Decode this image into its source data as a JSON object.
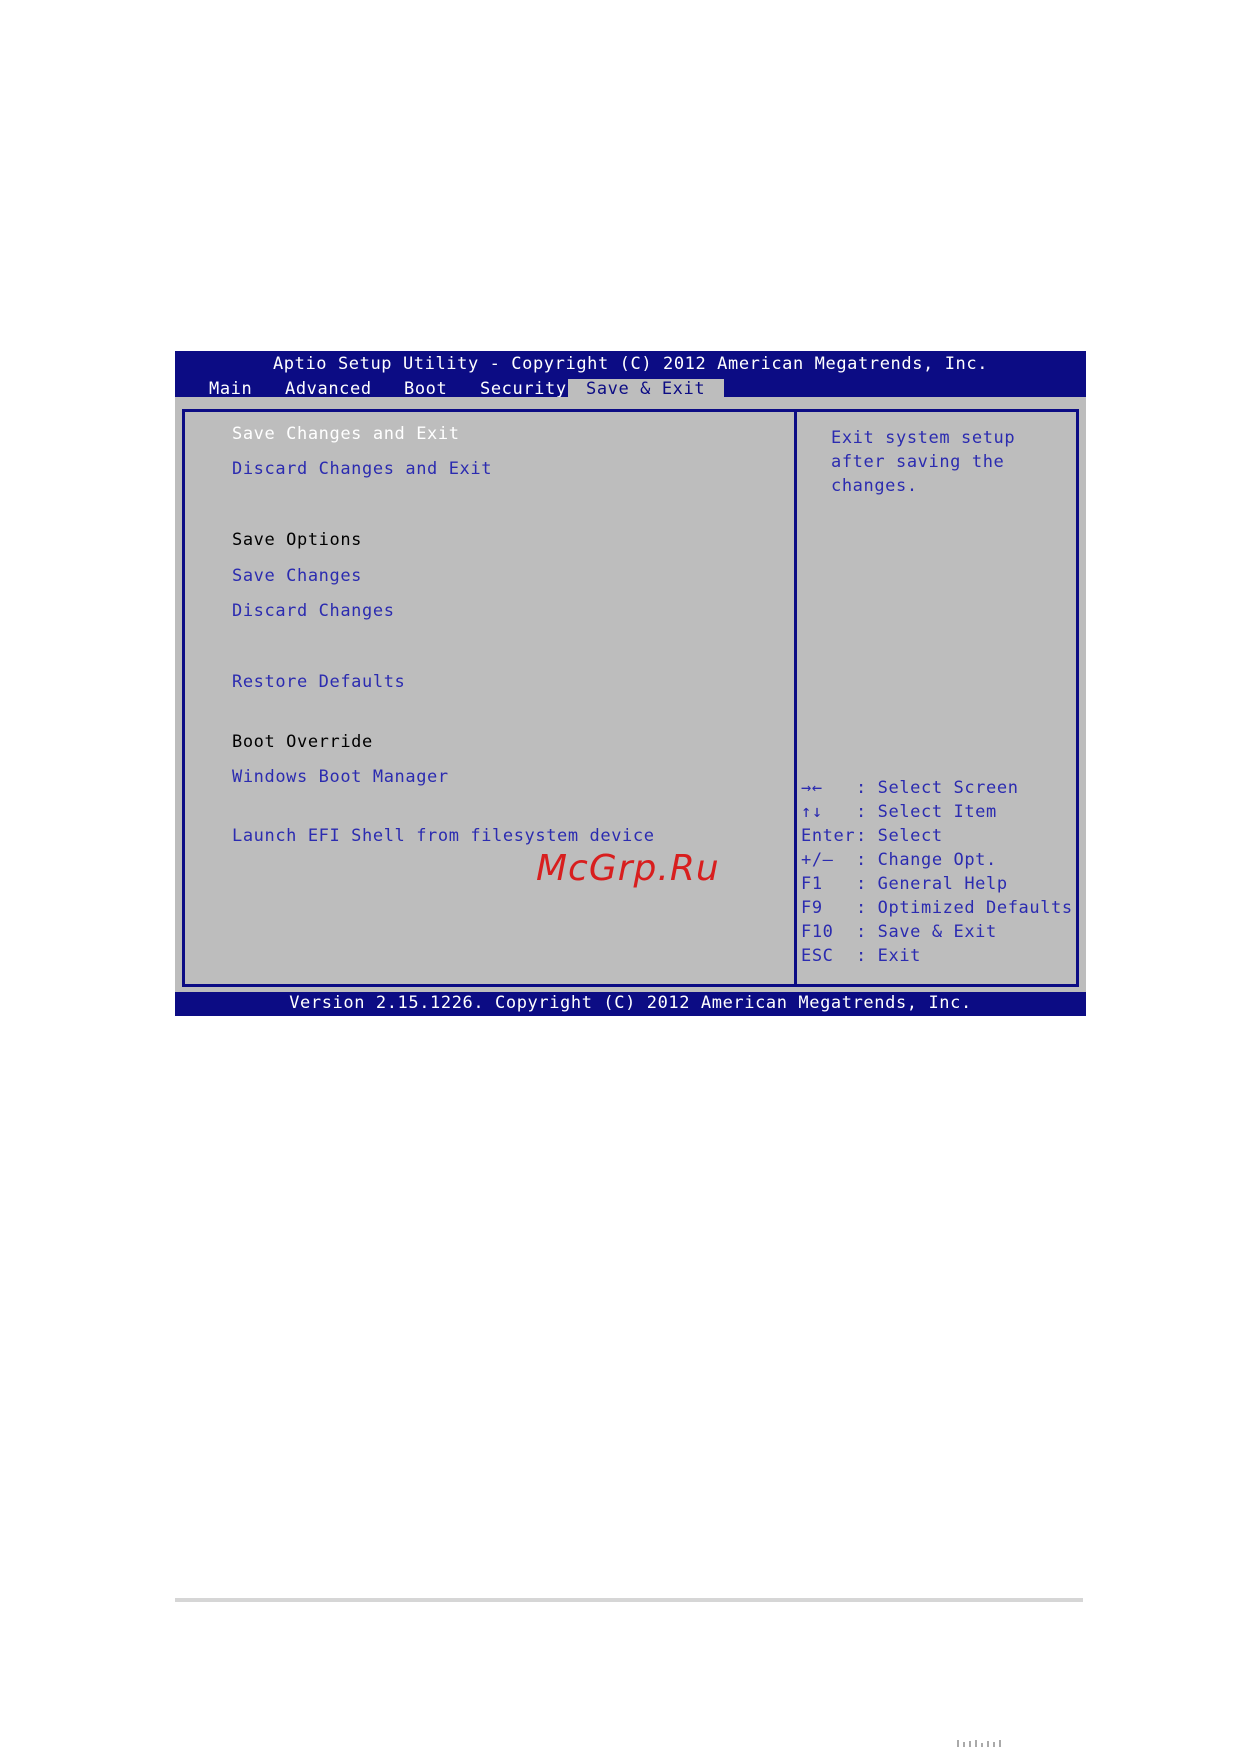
{
  "title_bar": "Aptio Setup Utility - Copyright (C) 2012 American Megatrends, Inc.",
  "tabs": [
    {
      "label": "Main"
    },
    {
      "label": "Advanced"
    },
    {
      "label": "Boot"
    },
    {
      "label": "Security"
    },
    {
      "label": "Save & Exit"
    }
  ],
  "active_tab": "Save & Exit",
  "menu": {
    "save_changes_and_exit": "Save Changes and Exit",
    "discard_changes_and_exit": "Discard Changes and Exit",
    "save_options_header": "Save Options",
    "save_changes": "Save Changes",
    "discard_changes": "Discard Changes",
    "restore_defaults": "Restore Defaults",
    "boot_override_header": "Boot Override",
    "windows_boot_manager": "Windows Boot Manager",
    "launch_efi_shell": "Launch EFI Shell from filesystem device"
  },
  "help_text": "Exit system setup\nafter saving the\nchanges.",
  "key_legend": [
    {
      "key": "→←",
      "desc": ": Select Screen"
    },
    {
      "key": "↑↓",
      "desc": ": Select Item"
    },
    {
      "key": "Enter",
      "desc": ": Select"
    },
    {
      "key": "+/—",
      "desc": ": Change Opt."
    },
    {
      "key": "F1",
      "desc": ": General Help"
    },
    {
      "key": "F9",
      "desc": ": Optimized Defaults"
    },
    {
      "key": "F10",
      "desc": ": Save & Exit"
    },
    {
      "key": "ESC",
      "desc": ": Exit"
    }
  ],
  "footer": "Version 2.15.1226. Copyright (C) 2012 American Megatrends, Inc.",
  "watermark": "McGrp.Ru",
  "colors": {
    "bios_blue": "#0c0c84",
    "bios_gray": "#bdbdbd",
    "item_blue": "#2b2bb0",
    "watermark_red": "#d81e1e"
  }
}
